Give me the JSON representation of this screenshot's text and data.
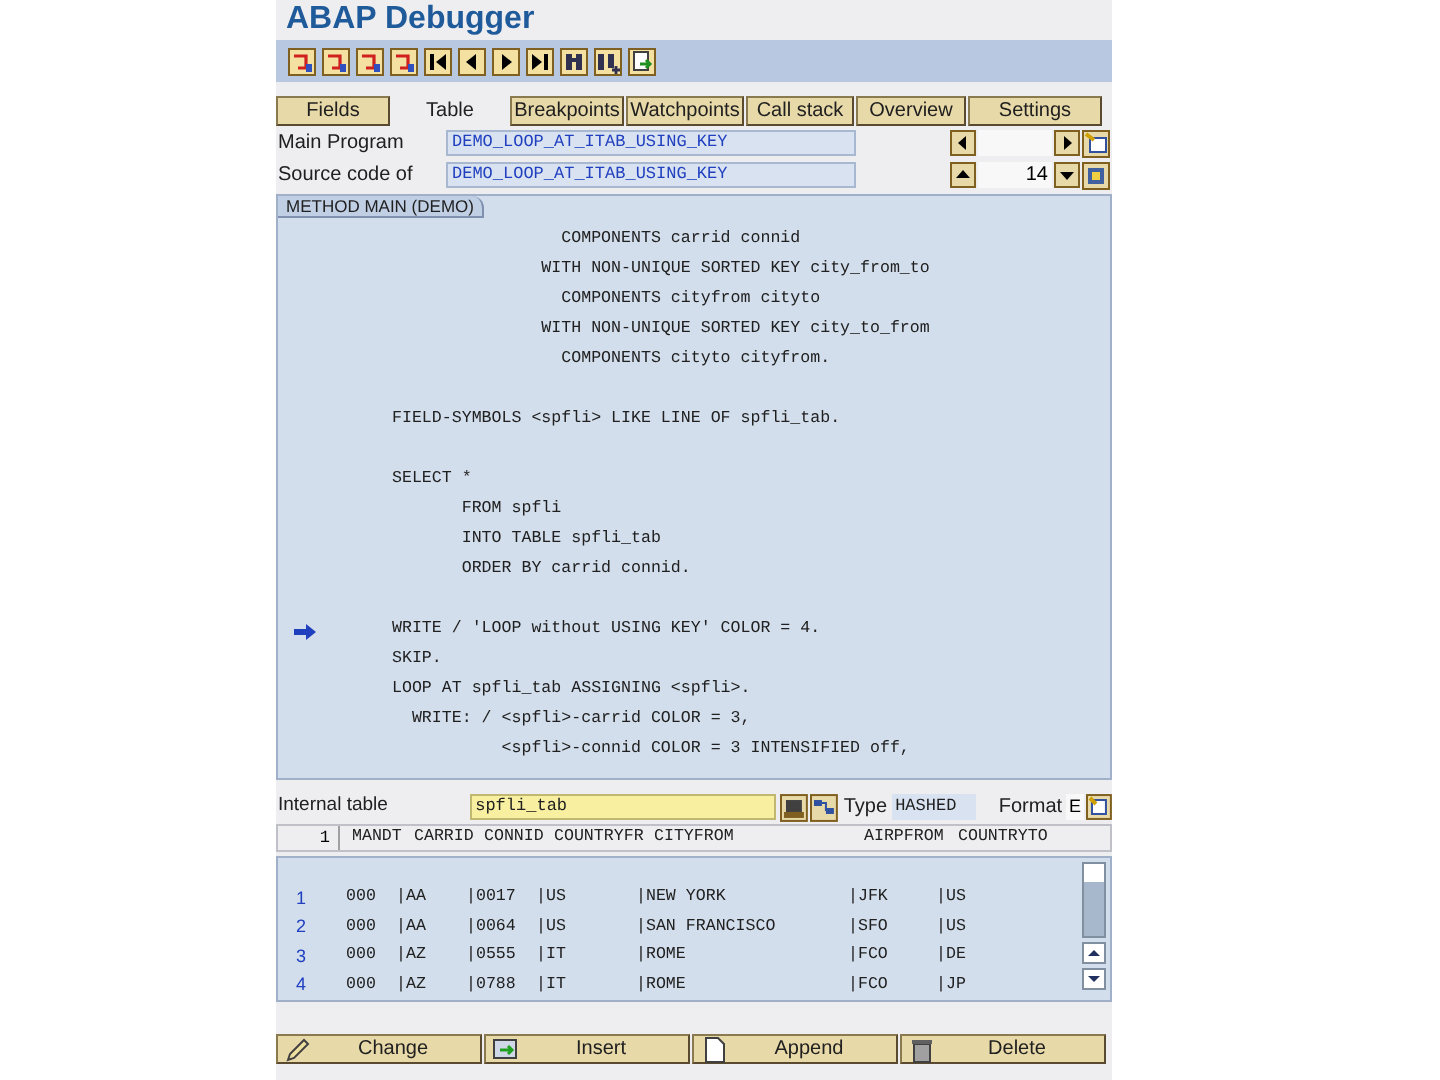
{
  "window": {
    "title": "ABAP Debugger"
  },
  "toolbar": {
    "buttons": [
      {
        "kind": "step"
      },
      {
        "kind": "step"
      },
      {
        "kind": "step"
      },
      {
        "kind": "step"
      },
      {
        "kind": "first"
      },
      {
        "kind": "previous"
      },
      {
        "kind": "next"
      },
      {
        "kind": "last"
      },
      {
        "kind": "find"
      },
      {
        "kind": "find_next"
      },
      {
        "kind": "export"
      }
    ]
  },
  "tabs": [
    {
      "label": "Fields",
      "selected": false
    },
    {
      "label": "Table",
      "selected": true
    },
    {
      "label": "Breakpoints",
      "selected": false
    },
    {
      "label": "Watchpoints",
      "selected": false
    },
    {
      "label": "Call stack",
      "selected": false
    },
    {
      "label": "Overview",
      "selected": false
    },
    {
      "label": "Settings",
      "selected": false
    }
  ],
  "main_program": {
    "label": "Main Program",
    "value": "DEMO_LOOP_AT_ITAB_USING_KEY"
  },
  "source_code_of": {
    "label": "Source code of",
    "value": "DEMO_LOOP_AT_ITAB_USING_KEY",
    "line": "14"
  },
  "code_panel": {
    "title": "METHOD MAIN (DEMO)",
    "lines": [
      {
        "text": "                 COMPONENTS carrid connid",
        "current": false
      },
      {
        "text": "               WITH NON-UNIQUE SORTED KEY city_from_to",
        "current": false
      },
      {
        "text": "                 COMPONENTS cityfrom cityto",
        "current": false
      },
      {
        "text": "               WITH NON-UNIQUE SORTED KEY city_to_from",
        "current": false
      },
      {
        "text": "                 COMPONENTS cityto cityfrom.",
        "current": false
      },
      {
        "current": false
      },
      {
        "text": "FIELD-SYMBOLS <spfli> LIKE LINE OF spfli_tab.",
        "current": false
      },
      {
        "current": false
      },
      {
        "text": "SELECT *",
        "current": false
      },
      {
        "text": "       FROM spfli",
        "current": false
      },
      {
        "text": "       INTO TABLE spfli_tab",
        "current": false
      },
      {
        "text": "       ORDER BY carrid connid.",
        "current": false
      },
      {
        "current": false
      },
      {
        "text": "WRITE / 'LOOP without USING KEY' COLOR = 4.",
        "current": true
      },
      {
        "text": "SKIP.",
        "current": false
      },
      {
        "text": "LOOP AT spfli_tab ASSIGNING <spfli>.",
        "current": false
      },
      {
        "text": "  WRITE: / <spfli>-carrid COLOR = 3,",
        "current": false
      },
      {
        "text": "           <spfli>-connid COLOR = 3 INTENSIFIED off,",
        "current": false
      }
    ]
  },
  "internal_table": {
    "label": "Internal table",
    "value": "spfli_tab",
    "type_label": "Type",
    "type": "HASHED",
    "format_label": "Format",
    "format": "E"
  },
  "table": {
    "first_column": "1",
    "columns": [
      "MANDT",
      "CARRID",
      "CONNID",
      "COUNTRYFR",
      "CITYFROM",
      "AIRPFROM",
      "COUNTRYTO"
    ],
    "rows": [
      {
        "number": "1",
        "cells": [
          "000",
          "|AA",
          "|0017",
          "|US",
          "|NEW YORK",
          "|JFK",
          "|US"
        ]
      },
      {
        "number": "2",
        "cells": [
          "000",
          "|AA",
          "|0064",
          "|US",
          "|SAN FRANCISCO",
          "|SFO",
          "|US"
        ]
      },
      {
        "number": "3",
        "cells": [
          "000",
          "|AZ",
          "|0555",
          "|IT",
          "|ROME",
          "|FCO",
          "|DE"
        ]
      },
      {
        "number": "4",
        "cells": [
          "000",
          "|AZ",
          "|0788",
          "|IT",
          "|ROME",
          "|FCO",
          "|JP"
        ]
      }
    ]
  },
  "buttons": [
    {
      "kind": "change",
      "label": "Change"
    },
    {
      "kind": "insert",
      "label": "Insert"
    },
    {
      "kind": "append",
      "label": "Append"
    },
    {
      "kind": "delete",
      "label": "Delete"
    }
  ]
}
